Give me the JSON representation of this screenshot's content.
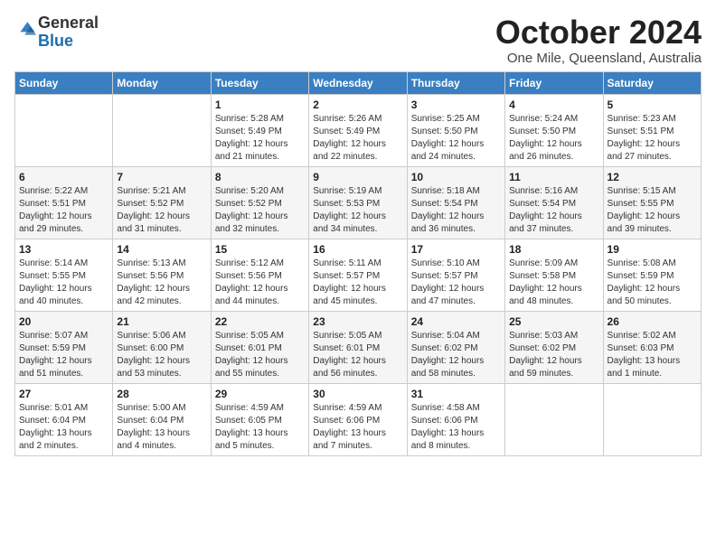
{
  "logo": {
    "general": "General",
    "blue": "Blue"
  },
  "header": {
    "month": "October 2024",
    "location": "One Mile, Queensland, Australia"
  },
  "weekdays": [
    "Sunday",
    "Monday",
    "Tuesday",
    "Wednesday",
    "Thursday",
    "Friday",
    "Saturday"
  ],
  "weeks": [
    [
      {
        "day": null
      },
      {
        "day": null
      },
      {
        "day": "1",
        "sunrise": "Sunrise: 5:28 AM",
        "sunset": "Sunset: 5:49 PM",
        "daylight": "Daylight: 12 hours and 21 minutes."
      },
      {
        "day": "2",
        "sunrise": "Sunrise: 5:26 AM",
        "sunset": "Sunset: 5:49 PM",
        "daylight": "Daylight: 12 hours and 22 minutes."
      },
      {
        "day": "3",
        "sunrise": "Sunrise: 5:25 AM",
        "sunset": "Sunset: 5:50 PM",
        "daylight": "Daylight: 12 hours and 24 minutes."
      },
      {
        "day": "4",
        "sunrise": "Sunrise: 5:24 AM",
        "sunset": "Sunset: 5:50 PM",
        "daylight": "Daylight: 12 hours and 26 minutes."
      },
      {
        "day": "5",
        "sunrise": "Sunrise: 5:23 AM",
        "sunset": "Sunset: 5:51 PM",
        "daylight": "Daylight: 12 hours and 27 minutes."
      }
    ],
    [
      {
        "day": "6",
        "sunrise": "Sunrise: 5:22 AM",
        "sunset": "Sunset: 5:51 PM",
        "daylight": "Daylight: 12 hours and 29 minutes."
      },
      {
        "day": "7",
        "sunrise": "Sunrise: 5:21 AM",
        "sunset": "Sunset: 5:52 PM",
        "daylight": "Daylight: 12 hours and 31 minutes."
      },
      {
        "day": "8",
        "sunrise": "Sunrise: 5:20 AM",
        "sunset": "Sunset: 5:52 PM",
        "daylight": "Daylight: 12 hours and 32 minutes."
      },
      {
        "day": "9",
        "sunrise": "Sunrise: 5:19 AM",
        "sunset": "Sunset: 5:53 PM",
        "daylight": "Daylight: 12 hours and 34 minutes."
      },
      {
        "day": "10",
        "sunrise": "Sunrise: 5:18 AM",
        "sunset": "Sunset: 5:54 PM",
        "daylight": "Daylight: 12 hours and 36 minutes."
      },
      {
        "day": "11",
        "sunrise": "Sunrise: 5:16 AM",
        "sunset": "Sunset: 5:54 PM",
        "daylight": "Daylight: 12 hours and 37 minutes."
      },
      {
        "day": "12",
        "sunrise": "Sunrise: 5:15 AM",
        "sunset": "Sunset: 5:55 PM",
        "daylight": "Daylight: 12 hours and 39 minutes."
      }
    ],
    [
      {
        "day": "13",
        "sunrise": "Sunrise: 5:14 AM",
        "sunset": "Sunset: 5:55 PM",
        "daylight": "Daylight: 12 hours and 40 minutes."
      },
      {
        "day": "14",
        "sunrise": "Sunrise: 5:13 AM",
        "sunset": "Sunset: 5:56 PM",
        "daylight": "Daylight: 12 hours and 42 minutes."
      },
      {
        "day": "15",
        "sunrise": "Sunrise: 5:12 AM",
        "sunset": "Sunset: 5:56 PM",
        "daylight": "Daylight: 12 hours and 44 minutes."
      },
      {
        "day": "16",
        "sunrise": "Sunrise: 5:11 AM",
        "sunset": "Sunset: 5:57 PM",
        "daylight": "Daylight: 12 hours and 45 minutes."
      },
      {
        "day": "17",
        "sunrise": "Sunrise: 5:10 AM",
        "sunset": "Sunset: 5:57 PM",
        "daylight": "Daylight: 12 hours and 47 minutes."
      },
      {
        "day": "18",
        "sunrise": "Sunrise: 5:09 AM",
        "sunset": "Sunset: 5:58 PM",
        "daylight": "Daylight: 12 hours and 48 minutes."
      },
      {
        "day": "19",
        "sunrise": "Sunrise: 5:08 AM",
        "sunset": "Sunset: 5:59 PM",
        "daylight": "Daylight: 12 hours and 50 minutes."
      }
    ],
    [
      {
        "day": "20",
        "sunrise": "Sunrise: 5:07 AM",
        "sunset": "Sunset: 5:59 PM",
        "daylight": "Daylight: 12 hours and 51 minutes."
      },
      {
        "day": "21",
        "sunrise": "Sunrise: 5:06 AM",
        "sunset": "Sunset: 6:00 PM",
        "daylight": "Daylight: 12 hours and 53 minutes."
      },
      {
        "day": "22",
        "sunrise": "Sunrise: 5:05 AM",
        "sunset": "Sunset: 6:01 PM",
        "daylight": "Daylight: 12 hours and 55 minutes."
      },
      {
        "day": "23",
        "sunrise": "Sunrise: 5:05 AM",
        "sunset": "Sunset: 6:01 PM",
        "daylight": "Daylight: 12 hours and 56 minutes."
      },
      {
        "day": "24",
        "sunrise": "Sunrise: 5:04 AM",
        "sunset": "Sunset: 6:02 PM",
        "daylight": "Daylight: 12 hours and 58 minutes."
      },
      {
        "day": "25",
        "sunrise": "Sunrise: 5:03 AM",
        "sunset": "Sunset: 6:02 PM",
        "daylight": "Daylight: 12 hours and 59 minutes."
      },
      {
        "day": "26",
        "sunrise": "Sunrise: 5:02 AM",
        "sunset": "Sunset: 6:03 PM",
        "daylight": "Daylight: 13 hours and 1 minute."
      }
    ],
    [
      {
        "day": "27",
        "sunrise": "Sunrise: 5:01 AM",
        "sunset": "Sunset: 6:04 PM",
        "daylight": "Daylight: 13 hours and 2 minutes."
      },
      {
        "day": "28",
        "sunrise": "Sunrise: 5:00 AM",
        "sunset": "Sunset: 6:04 PM",
        "daylight": "Daylight: 13 hours and 4 minutes."
      },
      {
        "day": "29",
        "sunrise": "Sunrise: 4:59 AM",
        "sunset": "Sunset: 6:05 PM",
        "daylight": "Daylight: 13 hours and 5 minutes."
      },
      {
        "day": "30",
        "sunrise": "Sunrise: 4:59 AM",
        "sunset": "Sunset: 6:06 PM",
        "daylight": "Daylight: 13 hours and 7 minutes."
      },
      {
        "day": "31",
        "sunrise": "Sunrise: 4:58 AM",
        "sunset": "Sunset: 6:06 PM",
        "daylight": "Daylight: 13 hours and 8 minutes."
      },
      {
        "day": null
      },
      {
        "day": null
      }
    ]
  ]
}
